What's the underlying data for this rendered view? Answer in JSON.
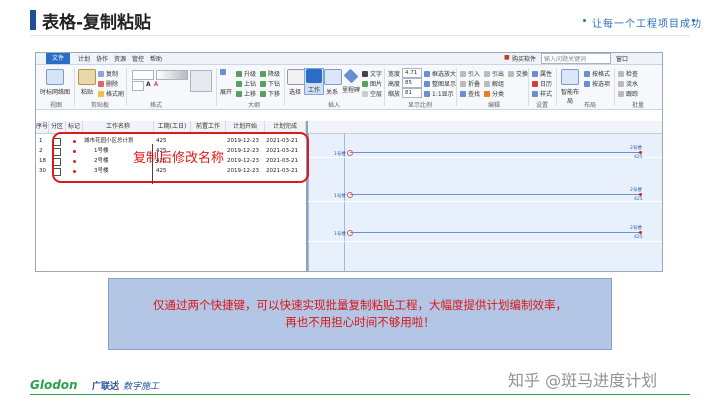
{
  "slide": {
    "title": "表格-复制粘贴",
    "slogan": "让每一个工程项目成功",
    "caption_line1": "仅通过两个快捷键，可以快速实现批量复制粘贴工程，大幅度提供计划编制效率，",
    "caption_line2": "再也不用担心时间不够用啦！",
    "annotation": "复制后修改名称",
    "footer_logo": "Glodon",
    "footer_cn": "广联达",
    "footer_tag": "数字施工",
    "watermark": "知乎 @斑马进度计划"
  },
  "app": {
    "menu": [
      "文件",
      "计划",
      "协作",
      "资源",
      "管控",
      "帮助"
    ],
    "menu_active": "文件",
    "top_right": {
      "buy": "购买软件",
      "search_placeholder": "输入问题关键词",
      "window": "窗口"
    },
    "ribbon": {
      "groups": [
        "视图",
        "剪贴板",
        "格式",
        "大纲",
        "插入",
        "显示比例",
        "编辑",
        "设置",
        "布局",
        "批量"
      ],
      "view": {
        "timescale": "时标网络图"
      },
      "clipboard": {
        "paste": "粘贴",
        "copy": "复制",
        "delete": "删除",
        "format": "格式刷"
      },
      "outline": {
        "upgrade": "升级",
        "downgrade": "降级",
        "up": "上钻",
        "down": "下钻",
        "top": "上移",
        "bottom": "下移",
        "expand": "展开"
      },
      "insert": {
        "select": "选择",
        "work": "工作",
        "relation": "关系",
        "milestone": "里程碑",
        "text": "文字",
        "picture": "图片",
        "empty": "空层"
      },
      "zoom": {
        "width_label": "宽度",
        "width_val": "4.71",
        "height_label": "高度",
        "height_val": "85",
        "scale_label": "缩放",
        "scale_val": "81",
        "fit_zoom": "框选放大",
        "fit_page": "整图显示",
        "one_to_one": "1:1显示"
      },
      "edit": {
        "import": "引入",
        "import2": "引出",
        "swap": "交换",
        "find": "查找",
        "fold": "折叠",
        "split": "解组",
        "partition": "分类"
      },
      "settings": {
        "attr": "属性",
        "calendar": "日历",
        "style": "样式"
      },
      "layout": {
        "smart": "智能布局",
        "format": "按格式",
        "select_col": "按选项"
      },
      "batch": {
        "check": "检查",
        "flow": "流水",
        "track": "跟踪"
      }
    },
    "table": {
      "headers": [
        "序号",
        "分区",
        "标记",
        "工作名称",
        "工期(工日)",
        "前置工作",
        "计划开始",
        "计划完成"
      ],
      "rows": [
        {
          "no": "1",
          "name": "城市花园小区总计划",
          "dur": "425",
          "pred": "",
          "start": "2019-12-23",
          "end": "2021-03-21"
        },
        {
          "no": "2",
          "name": "1号楼",
          "dur": "425",
          "pred": "",
          "start": "2019-12-23",
          "end": "2021-03-21"
        },
        {
          "no": "18",
          "name": "2号楼",
          "dur": "425",
          "pred": "",
          "start": "2019-12-23",
          "end": "2021-03-21"
        },
        {
          "no": "30",
          "name": "3号楼",
          "dur": "425",
          "pred": "",
          "start": "2019-12-23",
          "end": "2021-03-21"
        }
      ]
    },
    "gantt": {
      "marker_label": "2号楼",
      "dur_label": "425",
      "link_label": "1号楼"
    }
  },
  "colors": {
    "accent": "#1f4e9a",
    "annotation_red": "#e01818",
    "caption_bg": "#b3c6e6",
    "logo_green": "#2aa14a"
  }
}
